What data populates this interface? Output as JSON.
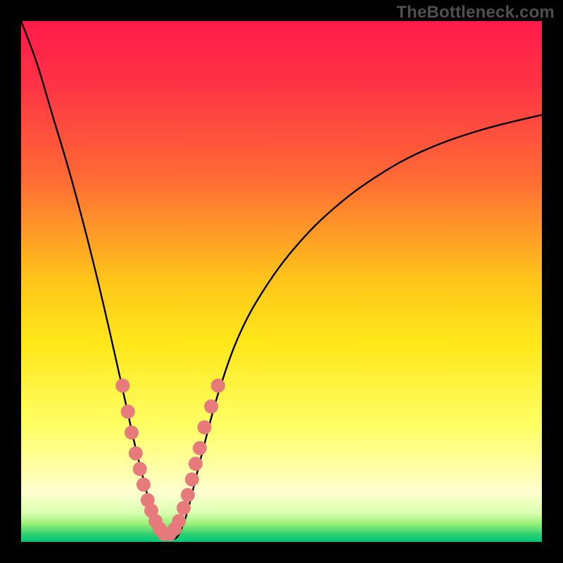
{
  "watermark": "TheBottleneck.com",
  "chart_data": {
    "type": "line",
    "title": "",
    "xlabel": "",
    "ylabel": "",
    "xlim": [
      0,
      100
    ],
    "ylim": [
      0,
      100
    ],
    "background_gradient": {
      "stops": [
        {
          "offset": 0.0,
          "color": "#ff1a4b"
        },
        {
          "offset": 0.12,
          "color": "#ff3346"
        },
        {
          "offset": 0.3,
          "color": "#ff6a35"
        },
        {
          "offset": 0.5,
          "color": "#ffc61a"
        },
        {
          "offset": 0.62,
          "color": "#ffe81a"
        },
        {
          "offset": 0.78,
          "color": "#ffff66"
        },
        {
          "offset": 0.86,
          "color": "#ffffa8"
        },
        {
          "offset": 0.905,
          "color": "#ffffd0"
        },
        {
          "offset": 0.945,
          "color": "#d8ffb0"
        },
        {
          "offset": 0.965,
          "color": "#9cf078"
        },
        {
          "offset": 0.985,
          "color": "#30d070"
        },
        {
          "offset": 1.0,
          "color": "#00c878"
        }
      ]
    },
    "series": [
      {
        "name": "bottleneck-curve",
        "color": "#000000",
        "x": [
          0,
          3,
          6,
          9,
          12,
          15,
          18,
          20,
          22,
          24,
          25,
          26,
          27,
          28,
          29,
          30,
          31,
          32,
          33,
          35,
          38,
          42,
          47,
          53,
          60,
          68,
          77,
          88,
          100
        ],
        "y": [
          100,
          92,
          82,
          72,
          61,
          49,
          36,
          27,
          18,
          10,
          6,
          3,
          1,
          0.5,
          0.5,
          1,
          3,
          6,
          10,
          18,
          29,
          40,
          49,
          57,
          64,
          70,
          75,
          79,
          82
        ]
      }
    ],
    "scatter": {
      "name": "highlight-points",
      "color": "#e77b7b",
      "radius": 10,
      "points": [
        {
          "x": 19.5,
          "y": 30
        },
        {
          "x": 20.5,
          "y": 25
        },
        {
          "x": 21.2,
          "y": 21
        },
        {
          "x": 22.0,
          "y": 17
        },
        {
          "x": 22.8,
          "y": 14
        },
        {
          "x": 23.5,
          "y": 11
        },
        {
          "x": 24.3,
          "y": 8
        },
        {
          "x": 25.0,
          "y": 6
        },
        {
          "x": 25.8,
          "y": 4
        },
        {
          "x": 26.6,
          "y": 2.5
        },
        {
          "x": 27.5,
          "y": 1.5
        },
        {
          "x": 28.5,
          "y": 1.5
        },
        {
          "x": 29.5,
          "y": 2.5
        },
        {
          "x": 30.3,
          "y": 4
        },
        {
          "x": 31.2,
          "y": 6.5
        },
        {
          "x": 32.0,
          "y": 9
        },
        {
          "x": 32.8,
          "y": 12
        },
        {
          "x": 33.5,
          "y": 15
        },
        {
          "x": 34.3,
          "y": 18
        },
        {
          "x": 35.2,
          "y": 22
        },
        {
          "x": 36.5,
          "y": 26
        },
        {
          "x": 37.8,
          "y": 30
        }
      ]
    }
  }
}
